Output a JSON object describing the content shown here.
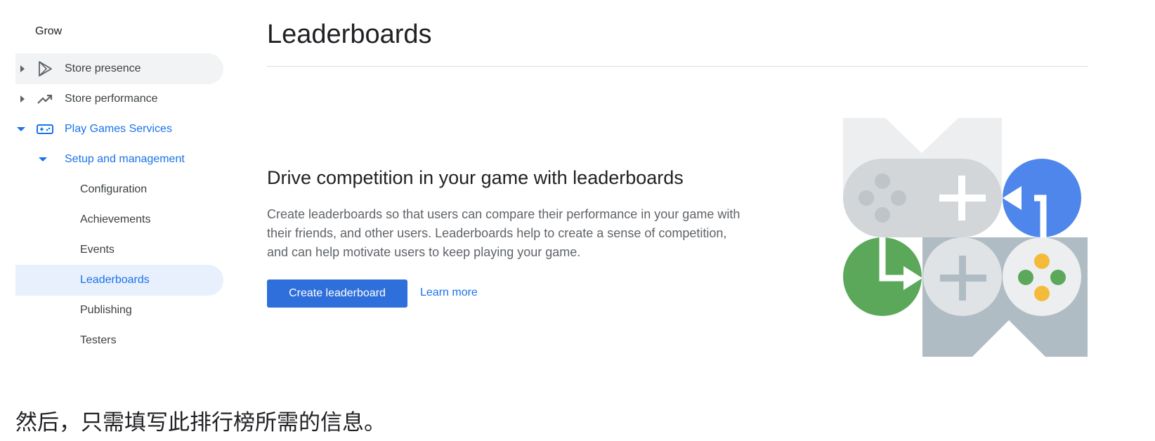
{
  "sidebar": {
    "section_title": "Grow",
    "items": [
      {
        "label": "Store presence",
        "icon": "play-store-icon"
      },
      {
        "label": "Store performance",
        "icon": "trending-up-icon"
      },
      {
        "label": "Play Games Services",
        "icon": "gamepad-icon"
      },
      {
        "label": "Setup and management"
      },
      {
        "label": "Configuration"
      },
      {
        "label": "Achievements"
      },
      {
        "label": "Events"
      },
      {
        "label": "Leaderboards"
      },
      {
        "label": "Publishing"
      },
      {
        "label": "Testers"
      }
    ]
  },
  "main": {
    "title": "Leaderboards",
    "promo": {
      "heading": "Drive competition in your game with leaderboards",
      "body": "Create leaderboards so that users can compare their performance in your game with their friends, and other users. Leaderboards help to create a sense of competition, and can help motivate users to keep playing your game.",
      "primary_button": "Create leaderboard",
      "link": "Learn more"
    }
  },
  "caption": "然后，只需填写此排行榜所需的信息。",
  "colors": {
    "accent": "#1a73e8",
    "button": "#2f6fdb",
    "selected_bg": "#e8f0fe",
    "hover_bg": "#f1f3f4",
    "green": "#5ba85a",
    "blue_circle": "#4f86ec",
    "yellow": "#f4bb3a"
  }
}
